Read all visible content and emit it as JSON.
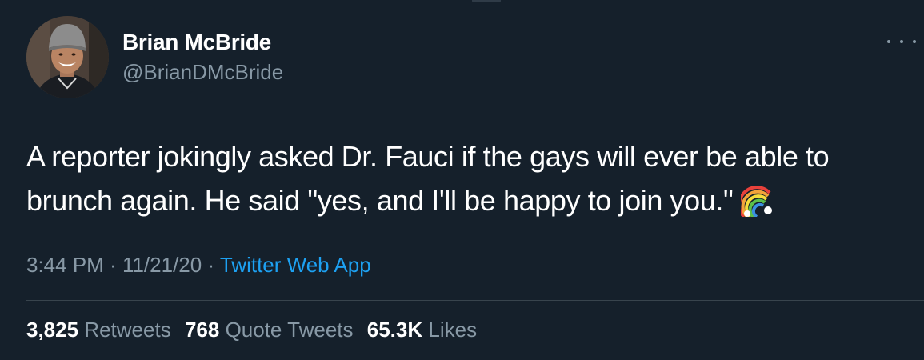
{
  "author": {
    "display_name": "Brian McBride",
    "handle": "@BrianDMcBride",
    "avatar_icon": "profile-photo"
  },
  "more_icon": "more-horizontal-icon",
  "tweet": {
    "line1": "A reporter jokingly asked Dr. Fauci if the gays will ever be able to",
    "line2": "brunch again. He said \"yes, and I'll be happy to join you.\"",
    "emoji": "rainbow-icon"
  },
  "meta": {
    "time": "3:44 PM",
    "sep1": " · ",
    "date": "11/21/20",
    "sep2": " · ",
    "source": "Twitter Web App"
  },
  "stats": {
    "retweets_count": "3,825",
    "retweets_label": "Retweets",
    "quotes_count": "768",
    "quotes_label": "Quote Tweets",
    "likes_count": "65.3K",
    "likes_label": "Likes"
  },
  "colors": {
    "background": "#15202b",
    "text_primary": "#ffffff",
    "text_secondary": "#8899a6",
    "link": "#1da1f2",
    "divider": "#38444d"
  }
}
